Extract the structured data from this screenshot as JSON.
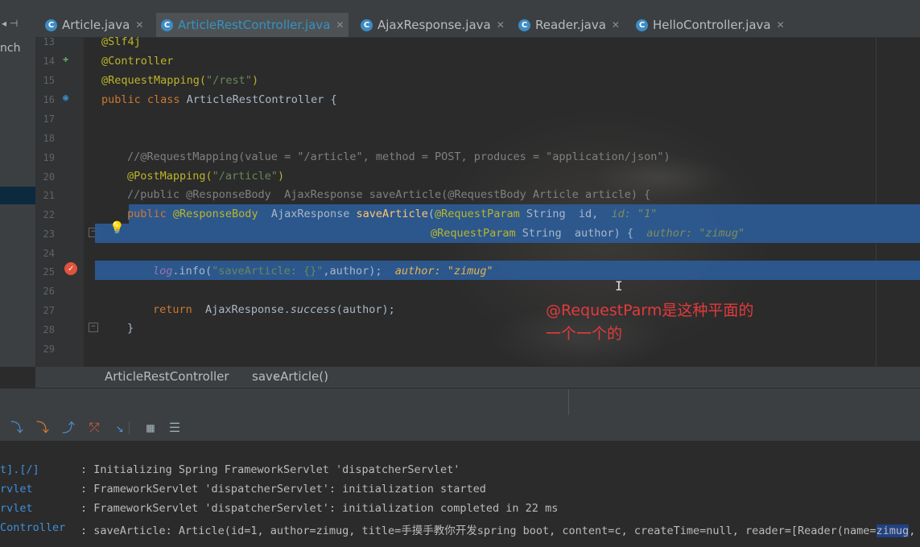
{
  "tabs": [
    {
      "label": "Article.java",
      "active": false
    },
    {
      "label": "ArticleRestController.java",
      "active": true
    },
    {
      "label": "AjaxResponse.java",
      "active": false
    },
    {
      "label": "Reader.java",
      "active": false
    },
    {
      "label": "HelloController.java",
      "active": false
    }
  ],
  "tab_nav": "◂ ⊣",
  "side_panel_text": "nch",
  "line_numbers": [
    "13",
    "14",
    "15",
    "16",
    "17",
    "18",
    "19",
    "20",
    "21",
    "22",
    "23",
    "24",
    "25",
    "26",
    "27",
    "28",
    "29"
  ],
  "code": {
    "l13": "@Slf4j",
    "l14": "@Controller",
    "l15_a": "@RequestMapping(",
    "l15_b": "\"/rest\"",
    "l15_c": ")",
    "l16_a": "public class ",
    "l16_b": "ArticleRestController {",
    "l19": "//@RequestMapping(value = \"/article\", method = POST, produces = \"application/json\")",
    "l20_a": "@PostMapping(",
    "l20_b": "\"/article\"",
    "l20_c": ")",
    "l21": "//public @ResponseBody  AjaxResponse saveArticle(@RequestBody Article article) {",
    "l22_kw": "public ",
    "l22_ann": "@ResponseBody",
    "l22_type": "  AjaxResponse ",
    "l22_fn": "saveArticle",
    "l22_p": "(",
    "l22_ann2": "@RequestParam",
    "l22_rest": " String  id,",
    "l22_hint": "  id: \"1\"",
    "l23_ann": "@RequestParam",
    "l23_rest": " String  author) {",
    "l23_hint": "  author: \"zimug\"",
    "l25_a": "log",
    "l25_b": ".info(",
    "l25_c": "\"saveArticle: {}\"",
    "l25_d": ",author);",
    "l25_hint": "  author: \"zimug\"",
    "l27_kw": "return",
    "l27_a": "  AjaxResponse.",
    "l27_b": "success",
    "l27_c": "(author);",
    "l28": "}"
  },
  "note": {
    "line1": "@RequestParm是这种平面的",
    "line2": "一个一个的"
  },
  "breadcrumb": {
    "class_name": "ArticleRestController",
    "method_name": "saveArticle()"
  },
  "toolbar_icons": [
    "step-over-icon",
    "step-into-icon",
    "force-step-into-icon",
    "step-out-icon",
    "drop-frame-icon",
    "run-to-cursor-icon",
    "evaluate-expression-icon",
    "trace-current-stream-icon"
  ],
  "console": [
    {
      "src": "t].[/]",
      "msg": ": Initializing Spring FrameworkServlet 'dispatcherServlet'"
    },
    {
      "src": "rvlet",
      "msg": ": FrameworkServlet 'dispatcherServlet': initialization started"
    },
    {
      "src": "rvlet",
      "msg": ": FrameworkServlet 'dispatcherServlet': initialization completed in 22 ms"
    },
    {
      "src": "Controller",
      "msg_a": ": saveArticle: Article(id=1, author=zimug, title=手摸手教你开发spring boot, content=c, createTime=null, reader=[Reader(name=",
      "msg_sel": "zimug",
      "msg_b": ", a"
    }
  ],
  "colors": {
    "active_tab_text": "#3592c4",
    "selection": "#2c5b96",
    "annotation_note": "#e23b3b"
  }
}
